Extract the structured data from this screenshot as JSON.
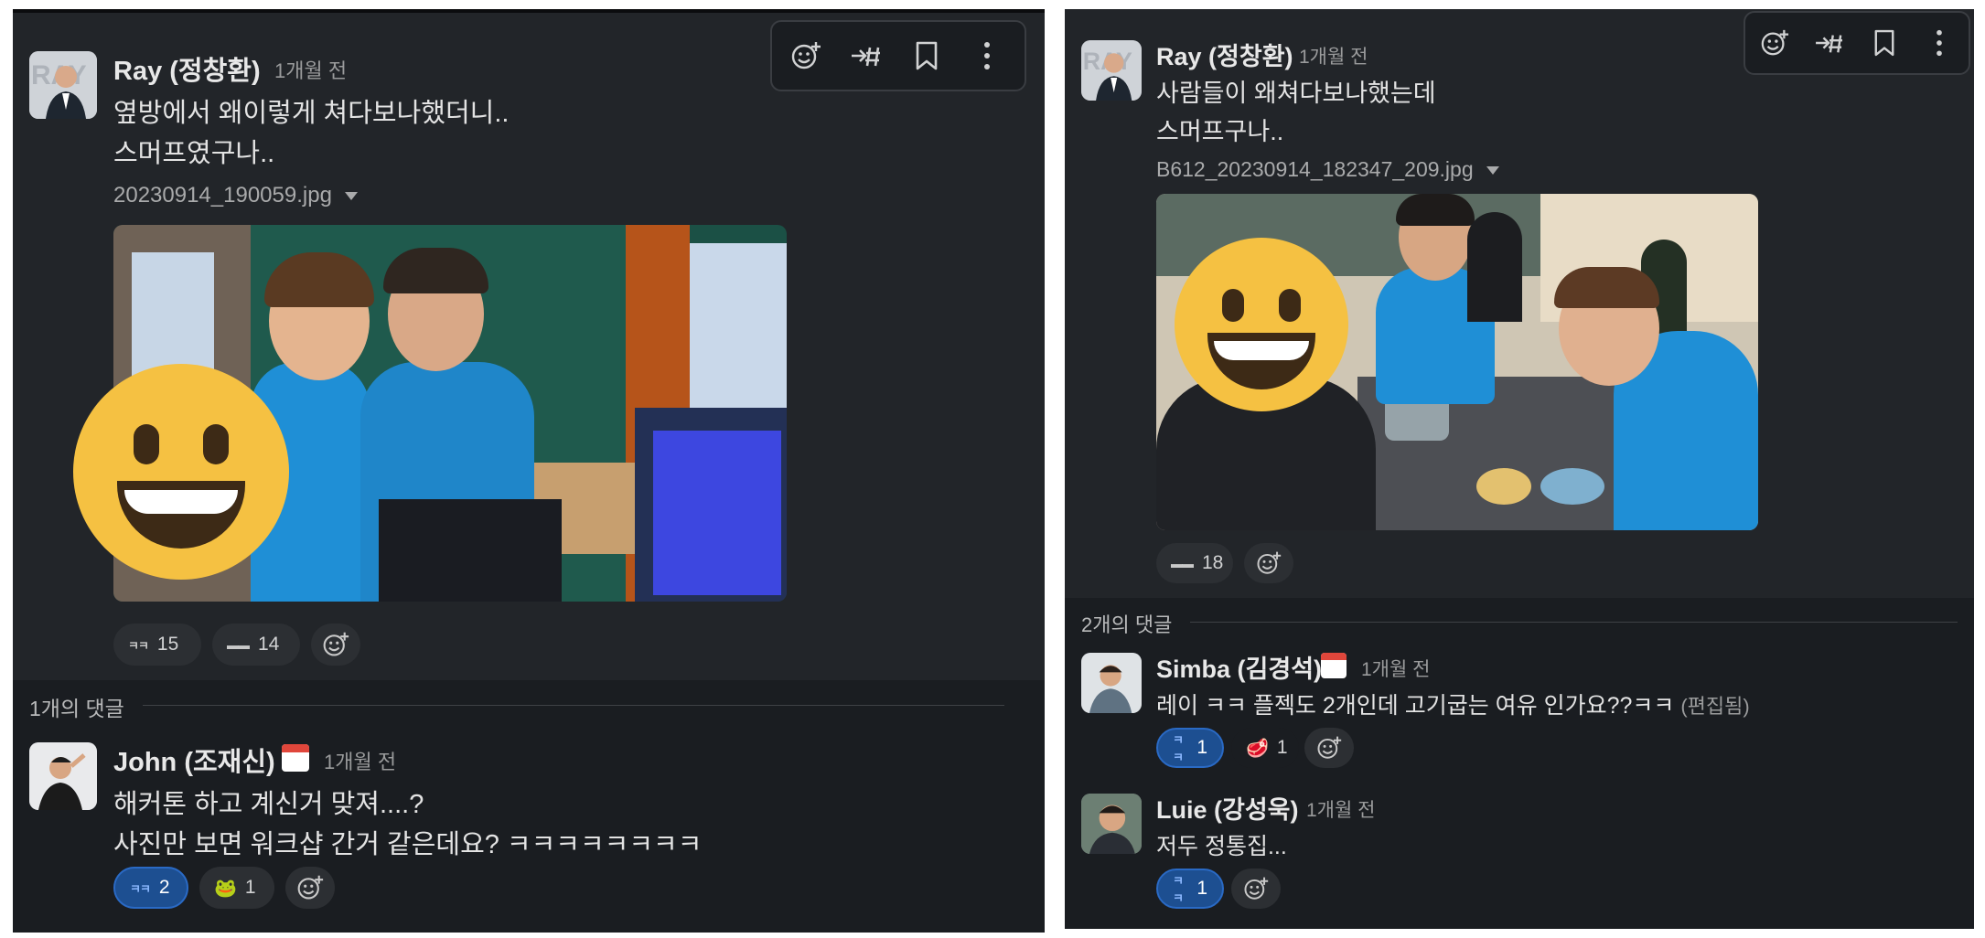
{
  "left_thread": {
    "post": {
      "author": "Ray (정창환)",
      "time": "1개월 전",
      "lines": [
        "옆방에서 왜이렇게 쳐다보나했더니..",
        "스머프였구나.."
      ],
      "file_name": "20230914_190059.jpg",
      "reactions": [
        {
          "emoji_name": "kk-emoji",
          "emoji_text": "ㅋㅋ",
          "count": "15"
        },
        {
          "emoji_name": "three-dots-emoji",
          "emoji_text": "▬▬",
          "count": "14"
        }
      ]
    },
    "reply_divider": "1개의 댓글",
    "comment": {
      "author": "John (조재신)",
      "time": "1개월 전",
      "lines": [
        "해커톤 하고 계신거 맞져....?",
        "사진만 보면 워크샵 간거 같은데요? ㅋㅋㅋㅋㅋㅋㅋㅋ"
      ],
      "reactions": [
        {
          "emoji_text": "ㅋㅋ",
          "count": "2",
          "active": true
        },
        {
          "emoji_text": "🐸",
          "count": "1"
        }
      ]
    }
  },
  "right_thread": {
    "post": {
      "author": "Ray (정창환)",
      "time": "1개월 전",
      "lines": [
        "사람들이 왜쳐다보나했는데",
        "스머프구나.."
      ],
      "file_name": "B612_20230914_182347_209.jpg",
      "reactions": [
        {
          "emoji_text": "▬▬",
          "count": "18"
        }
      ]
    },
    "reply_divider": "2개의 댓글",
    "comments": [
      {
        "author": "Simba (김경석)",
        "time": "1개월 전",
        "line": "레이 ㅋㅋ 플젝도 2개인데 고기굽는 여유 인가요??ㅋㅋ",
        "edited": "(편집됨)",
        "reactions": [
          {
            "emoji_text": "ㅋㅋ",
            "count": "1",
            "active": true
          },
          {
            "emoji_text": "🥩",
            "count": "1"
          }
        ]
      },
      {
        "author": "Luie (강성욱)",
        "time": "1개월 전",
        "line": "저두 정통집...",
        "reactions": [
          {
            "emoji_text": "ㅋㅋ",
            "count": "1",
            "active": true
          }
        ]
      }
    ]
  },
  "toolbar_icons": [
    "add-reaction-icon",
    "share-to-channel-icon",
    "bookmark-icon",
    "more-actions-icon"
  ],
  "colors": {
    "background": "#1a1d21",
    "hover_bg": "#222529",
    "active_reaction": "#1d4f91",
    "smiley": "#f5c142",
    "shirt": "#1f8fd6"
  }
}
